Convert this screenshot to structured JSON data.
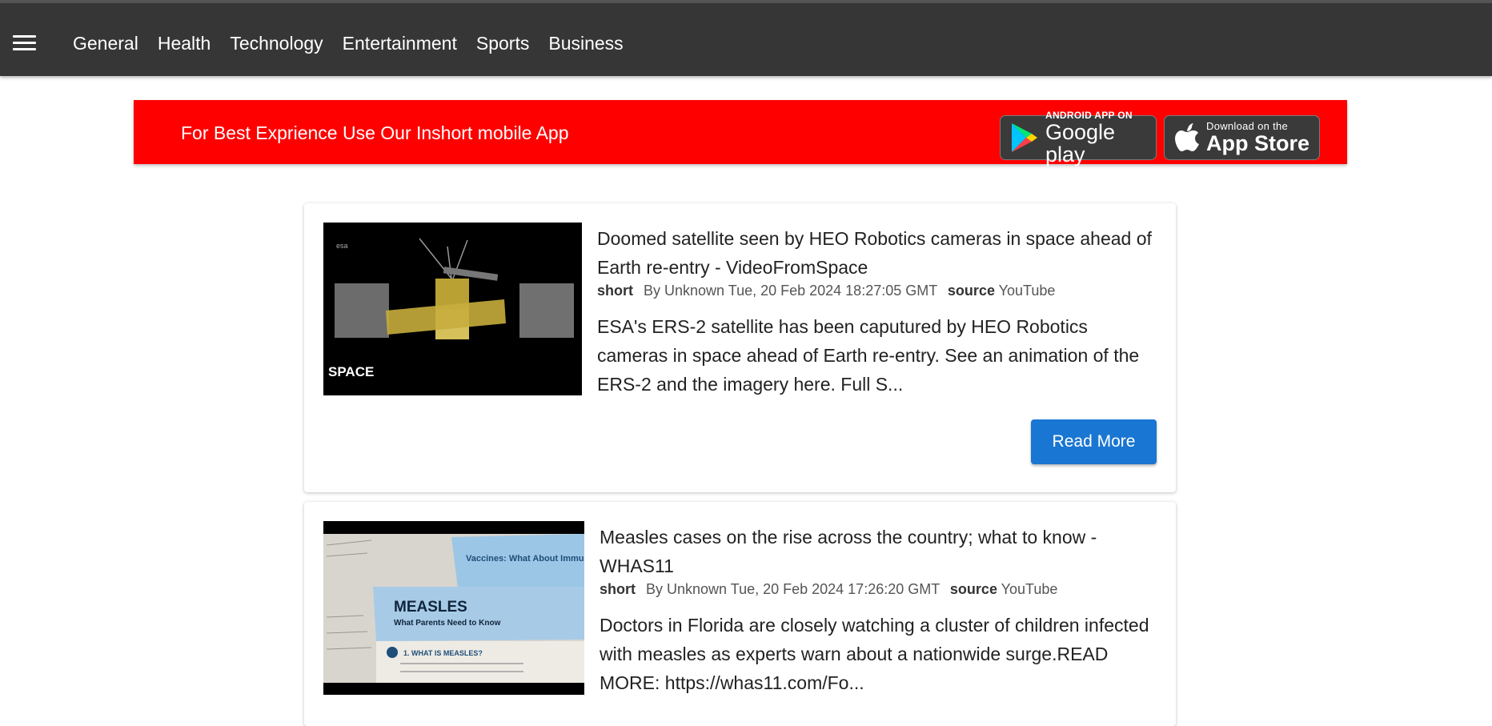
{
  "nav": {
    "menu_icon": "hamburger-menu-icon",
    "links": [
      "General",
      "Health",
      "Technology",
      "Entertainment",
      "Sports",
      "Business"
    ]
  },
  "banner": {
    "text": "For Best Exprience Use Our Inshort mobile App",
    "google_play": {
      "small": "ANDROID APP ON",
      "big": "Google play",
      "icon": "google-play-icon"
    },
    "app_store": {
      "small": "Download on the",
      "big": "App Store",
      "icon": "apple-icon"
    },
    "color": "#ff0000"
  },
  "articles": [
    {
      "title": "Doomed satellite seen by HEO Robotics cameras in space ahead of Earth re-entry - VideoFromSpace",
      "short_label": "short",
      "by": "By Unknown Tue, 20 Feb 2024 18:27:05 GMT",
      "source_label": "source",
      "source": "YouTube",
      "description": "ESA's ERS-2 satellite has been caputured by HEO Robotics cameras in space ahead of Earth re-entry. See an animation of the ERS-2 and the imagery here. Full S...",
      "thumb_logo": "SPACE",
      "thumb_tag": "esa",
      "button": "Read More"
    },
    {
      "title": "Measles cases on the rise across the country; what to know - WHAS11",
      "short_label": "short",
      "by": "By Unknown Tue, 20 Feb 2024 17:26:20 GMT",
      "source_label": "source",
      "source": "YouTube",
      "description": "Doctors in Florida are closely watching a cluster of children infected with measles as experts warn about a nationwide surge.READ MORE: https://whas11.com/Fo...",
      "thumb_heading": "MEASLES",
      "thumb_sub": "What Parents Need to Know",
      "thumb_tab": "Vaccines: What About Immunocompromised",
      "thumb_q": "1. WHAT IS MEASLES?"
    }
  ],
  "colors": {
    "navbar": "#363636",
    "button": "#1976d2"
  }
}
